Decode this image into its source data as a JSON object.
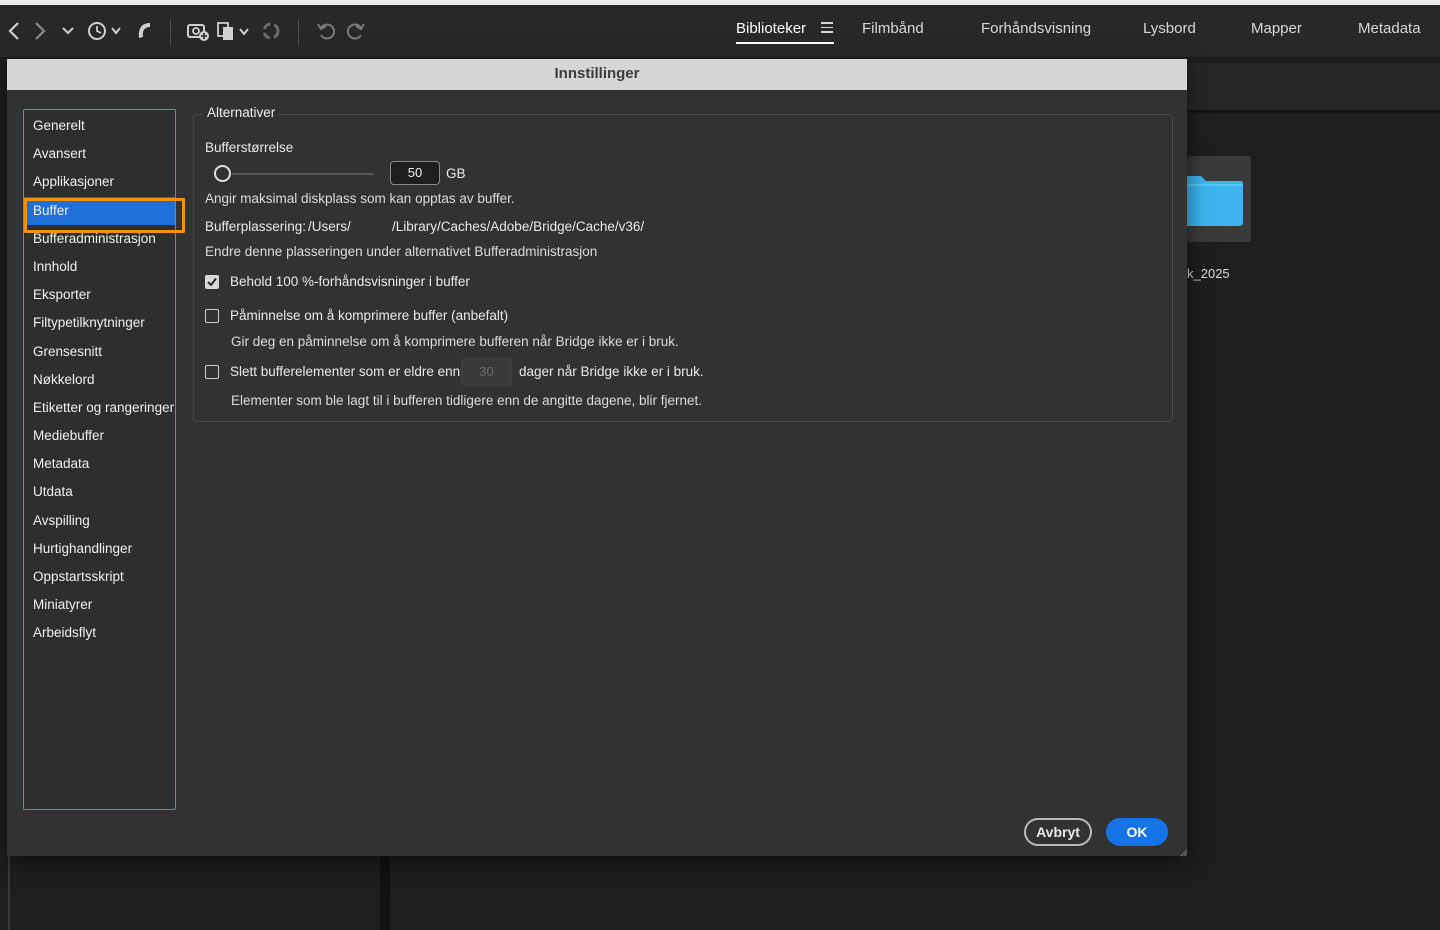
{
  "toolbar": {
    "icons": [
      "back-arrow-icon",
      "forward-arrow-icon",
      "chevron-down-icon",
      "recent-history-icon",
      "boomerang-icon",
      "camera-download-icon",
      "file-copy-icon",
      "rotate-icon",
      "rotate-left-icon",
      "rotate-right-icon"
    ]
  },
  "workspaces": {
    "tabs": [
      {
        "label": "Biblioteker",
        "active": true
      },
      {
        "label": "Filmbånd",
        "active": false
      },
      {
        "label": "Forhåndsvisning",
        "active": false
      },
      {
        "label": "Lysbord",
        "active": false
      },
      {
        "label": "Mapper",
        "active": false
      },
      {
        "label": "Metadata",
        "active": false
      }
    ]
  },
  "background": {
    "folder_label": "k_2025",
    "folder_icon": "folder-icon",
    "folder_color": "#3db4ef"
  },
  "dialog": {
    "title": "Innstillinger",
    "categories": [
      "Generelt",
      "Avansert",
      "Applikasjoner",
      "Buffer",
      "Bufferadministrasjon",
      "Innhold",
      "Eksporter",
      "Filtypetilknytninger",
      "Grensesnitt",
      "Nøkkelord",
      "Etiketter og rangeringer",
      "Mediebuffer",
      "Metadata",
      "Utdata",
      "Avspilling",
      "Hurtighandlinger",
      "Oppstartsskript",
      "Miniatyrer",
      "Arbeidsflyt"
    ],
    "selected_category": "Buffer",
    "options": {
      "group_title": "Alternativer",
      "buffer_size_label": "Bufferstørrelse",
      "buffer_size_value": "50",
      "buffer_size_unit": "GB",
      "buffer_size_desc": "Angir maksimal diskplass som kan opptas av buffer.",
      "buffer_location_label": "Bufferplassering:",
      "buffer_location_part1": "/Users/",
      "buffer_location_part2": "/Library/Caches/Adobe/Bridge/Cache/v36/",
      "buffer_location_desc": "Endre denne plasseringen under alternativet Bufferadministrasjon",
      "keep_previews_label": "Behold 100 %-forhåndsvisninger i buffer",
      "keep_previews_checked": true,
      "remind_compress_label": "Påminnelse om å komprimere buffer (anbefalt)",
      "remind_compress_checked": false,
      "remind_compress_desc": "Gir deg en påminnelse om å komprimere bufferen når Bridge ikke er i bruk.",
      "delete_old_label": "Slett bufferelementer som er eldre enn",
      "delete_old_checked": false,
      "delete_old_days": "30",
      "delete_old_suffix": "dager når Bridge ikke er i bruk.",
      "delete_old_desc": "Elementer som ble lagt til i bufferen tidligere enn de angitte dagene, blir fjernet."
    },
    "buttons": {
      "cancel": "Avbryt",
      "ok": "OK"
    }
  }
}
